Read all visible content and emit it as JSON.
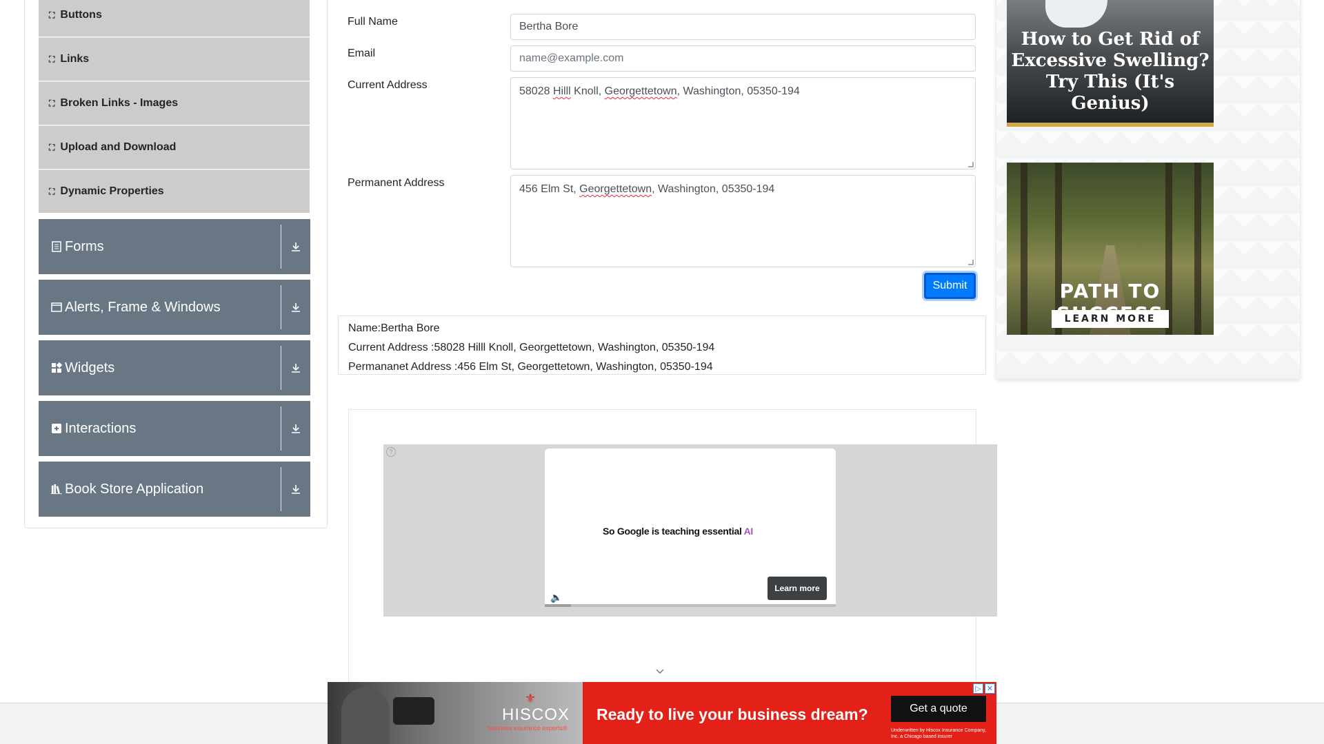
{
  "sidebar": {
    "elements_items": [
      {
        "label": "Buttons"
      },
      {
        "label": "Links"
      },
      {
        "label": "Broken Links - Images"
      },
      {
        "label": "Upload and Download"
      },
      {
        "label": "Dynamic Properties"
      }
    ],
    "groups": [
      {
        "label": "Forms",
        "icon": "forms-icon"
      },
      {
        "label": "Alerts, Frame & Windows",
        "icon": "window-icon"
      },
      {
        "label": "Widgets",
        "icon": "widgets-icon"
      },
      {
        "label": "Interactions",
        "icon": "interactions-icon"
      },
      {
        "label": "Book Store Application",
        "icon": "books-icon"
      }
    ]
  },
  "form": {
    "full_name_label": "Full Name",
    "full_name_value": "Bertha Bore",
    "email_label": "Email",
    "email_placeholder": "name@example.com",
    "current_address_label": "Current Address",
    "current_address_parts": [
      "58028 ",
      "Hilll",
      " Knoll, ",
      "Georgettetown",
      ", Washington, 05350-194"
    ],
    "permanent_address_label": "Permanent Address",
    "permanent_address_parts": [
      "456 Elm St, ",
      "Georgettetown",
      ", Washington, 05350-194"
    ],
    "submit_label": "Submit"
  },
  "output": {
    "name_line": "Name:Bertha Bore",
    "current_line": "Current Address :58028 Hilll Knoll, Georgettetown, Washington, 05350-194",
    "permanent_line": "Permananet Address :456 Elm St, Georgettetown, Washington, 05350-194"
  },
  "ads": {
    "google": {
      "headline": "So Google is teaching essential ",
      "headline_accent": "AI",
      "cta": "Learn more",
      "progress": 0.09
    },
    "swelling": {
      "headline": "How to Get Rid of Excessive Swelling? Try This (It's Genius)"
    },
    "path": {
      "title": "PATH TO SUCCESS",
      "cta": "LEARN MORE"
    },
    "hiscox": {
      "brand": "HISCOX",
      "brand_sub": "business insurance experts®",
      "headline": "Ready to live your business dream?",
      "cta": "Get a quote",
      "fine_print": "Underwritten by Hiscox Insurance Company, Inc. a Chicago based insurer"
    }
  },
  "colors": {
    "accent": "#007bff",
    "sidebar_group_bg": "#697785",
    "sidebar_item_bg": "#cccccc",
    "hiscox_red": "#e32119"
  }
}
